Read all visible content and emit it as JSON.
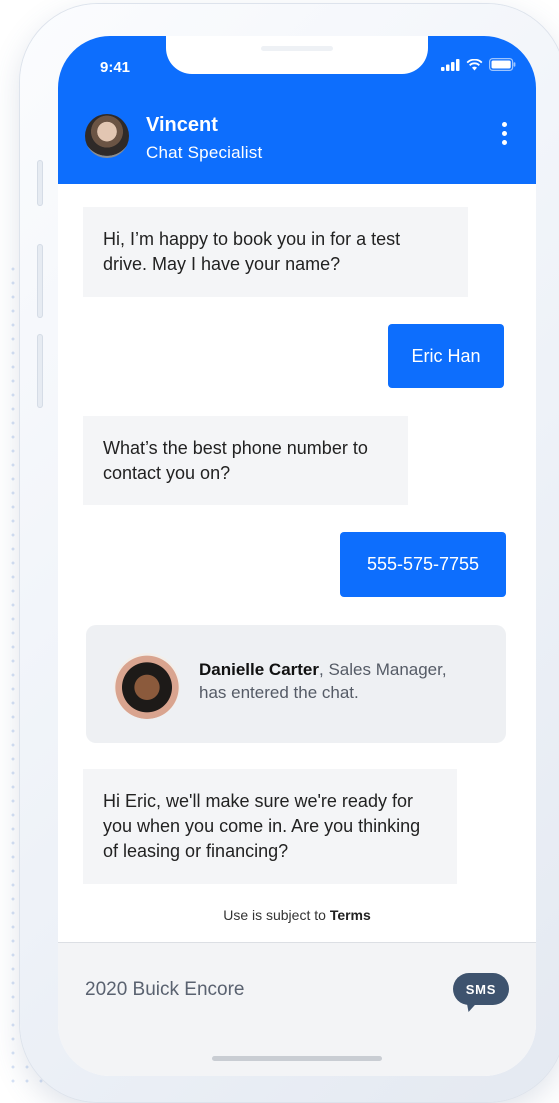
{
  "status_bar": {
    "time": "9:41",
    "icons": [
      "signal-icon",
      "wifi-icon",
      "battery-icon"
    ]
  },
  "header": {
    "agent_name": "Vincent",
    "agent_role": "Chat Specialist",
    "menu_icon": "kebab-menu-icon",
    "background_color": "#0d6efd"
  },
  "messages": [
    {
      "from": "bot",
      "text": "Hi, I’m happy to book you in for a test drive. May I have your name?"
    },
    {
      "from": "user",
      "text": "Eric Han"
    },
    {
      "from": "bot",
      "text": "What’s the best phone number to contact you on?"
    },
    {
      "from": "user",
      "text": "555-575-7755"
    },
    {
      "from": "bot",
      "text": "Hi Eric, we'll make sure we're ready for you when you come in. Are you thinking of leasing or financing?"
    }
  ],
  "notice": {
    "name": "Danielle Carter",
    "role": " Sales Manager,",
    "text": "has entered the chat."
  },
  "terms": {
    "prefix": "Use is subject to ",
    "link": "Terms"
  },
  "composer": {
    "value": "2020 Buick Encore",
    "send_label": "SMS",
    "send_color": "#3e536e"
  }
}
